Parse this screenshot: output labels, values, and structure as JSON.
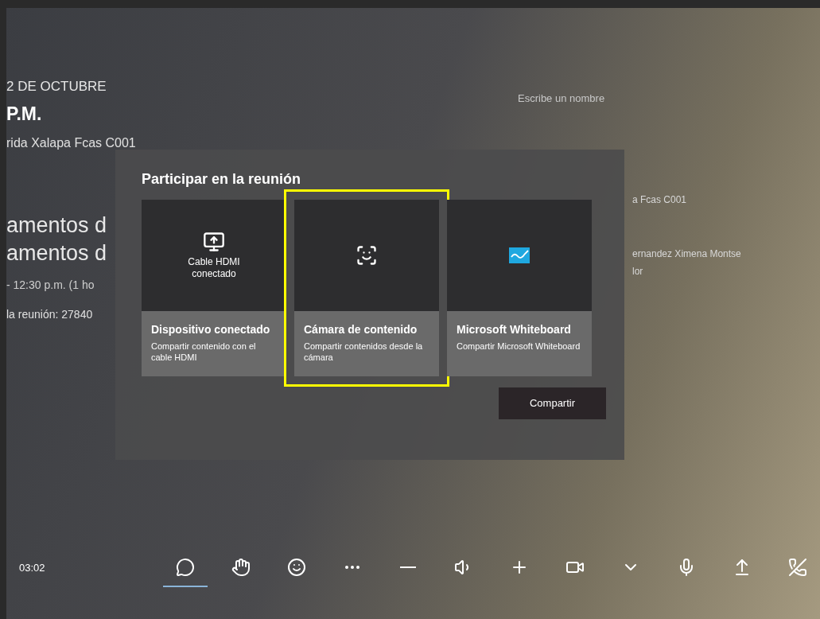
{
  "meeting": {
    "date": "2 DE OCTUBRE",
    "time": "P.M.",
    "room": "rida Xalapa Fcas C001",
    "titles": [
      "amentos d",
      "amentos d"
    ],
    "schedule": "- 12:30 p.m. (1 ho",
    "meeting_id": "la reunión: 27840"
  },
  "side_panel": {
    "search": {
      "placeholder": "Escribe un nombre"
    },
    "items": [
      "a Fcas C001",
      "ernandez Ximena Montse",
      "lor"
    ]
  },
  "dialog": {
    "title": "Participar en la reunión",
    "cards": [
      {
        "kind": "hdmi",
        "icon_caption": "Cable HDMI conectado",
        "title": "Dispositivo conectado",
        "description": "Compartir contenido con el cable HDMI",
        "highlighted": false
      },
      {
        "kind": "camera",
        "title": "Cámara de contenido",
        "description": "Compartir contenidos desde la cámara",
        "highlighted": true
      },
      {
        "kind": "whiteboard",
        "title": "Microsoft Whiteboard",
        "description": "Compartir Microsoft Whiteboard",
        "highlighted": false
      }
    ],
    "share_button": "Compartir"
  },
  "toolbar": {
    "timer": "03:02",
    "buttons": [
      {
        "kind": "chat",
        "selected": true
      },
      {
        "kind": "hand",
        "selected": false
      },
      {
        "kind": "emoji",
        "selected": false
      },
      {
        "kind": "more",
        "selected": false
      },
      {
        "kind": "minus",
        "selected": false
      },
      {
        "kind": "speaker",
        "selected": false
      },
      {
        "kind": "plus",
        "selected": false
      },
      {
        "kind": "video",
        "selected": false
      },
      {
        "kind": "chevron",
        "selected": false
      },
      {
        "kind": "mic",
        "selected": false
      },
      {
        "kind": "share",
        "selected": false
      },
      {
        "kind": "hangup",
        "selected": false
      }
    ]
  }
}
